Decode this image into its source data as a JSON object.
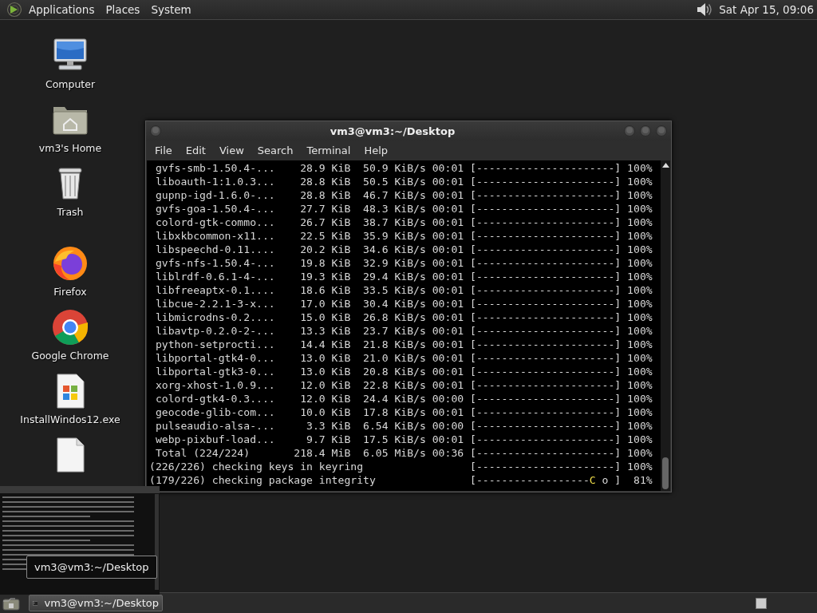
{
  "top_panel": {
    "menus": [
      {
        "label": "Applications"
      },
      {
        "label": "Places"
      },
      {
        "label": "System"
      }
    ],
    "clock": "Sat Apr 15, 09:06"
  },
  "desktop_icons": [
    {
      "kind": "computer",
      "label": "Computer"
    },
    {
      "kind": "home",
      "label": "vm3's Home"
    },
    {
      "kind": "trash",
      "label": "Trash"
    },
    {
      "kind": "firefox",
      "label": "Firefox"
    },
    {
      "kind": "chrome",
      "label": "Google Chrome"
    },
    {
      "kind": "exe",
      "label": "InstallWindos12.exe"
    },
    {
      "kind": "file"
    }
  ],
  "terminal": {
    "title": "vm3@vm3:~/Desktop",
    "menus": [
      {
        "label": "File"
      },
      {
        "label": "Edit"
      },
      {
        "label": "View"
      },
      {
        "label": "Search"
      },
      {
        "label": "Terminal"
      },
      {
        "label": "Help"
      }
    ],
    "lines": [
      {
        "kind": "text",
        "text": " gvfs-smb-1.50.4-...    28.9 KiB  50.9 KiB/s 00:01 [----------------------] 100%"
      },
      {
        "kind": "text",
        "text": " liboauth-1:1.0.3...    28.8 KiB  50.5 KiB/s 00:01 [----------------------] 100%"
      },
      {
        "kind": "text",
        "text": " gupnp-igd-1.6.0-...    28.8 KiB  46.7 KiB/s 00:01 [----------------------] 100%"
      },
      {
        "kind": "text",
        "text": " gvfs-goa-1.50.4-...    27.7 KiB  48.3 KiB/s 00:01 [----------------------] 100%"
      },
      {
        "kind": "text",
        "text": " colord-gtk-commo...    26.7 KiB  38.7 KiB/s 00:01 [----------------------] 100%"
      },
      {
        "kind": "text",
        "text": " libxkbcommon-x11...    22.5 KiB  35.9 KiB/s 00:01 [----------------------] 100%"
      },
      {
        "kind": "text",
        "text": " libspeechd-0.11....    20.2 KiB  34.6 KiB/s 00:01 [----------------------] 100%"
      },
      {
        "kind": "text",
        "text": " gvfs-nfs-1.50.4-...    19.8 KiB  32.9 KiB/s 00:01 [----------------------] 100%"
      },
      {
        "kind": "text",
        "text": " liblrdf-0.6.1-4-...    19.3 KiB  29.4 KiB/s 00:01 [----------------------] 100%"
      },
      {
        "kind": "text",
        "text": " libfreeaptx-0.1....    18.6 KiB  33.5 KiB/s 00:01 [----------------------] 100%"
      },
      {
        "kind": "text",
        "text": " libcue-2.2.1-3-x...    17.0 KiB  30.4 KiB/s 00:01 [----------------------] 100%"
      },
      {
        "kind": "text",
        "text": " libmicrodns-0.2....    15.0 KiB  26.8 KiB/s 00:01 [----------------------] 100%"
      },
      {
        "kind": "text",
        "text": " libavtp-0.2.0-2-...    13.3 KiB  23.7 KiB/s 00:01 [----------------------] 100%"
      },
      {
        "kind": "text",
        "text": " python-setprocti...    14.4 KiB  21.8 KiB/s 00:01 [----------------------] 100%"
      },
      {
        "kind": "text",
        "text": " libportal-gtk4-0...    13.0 KiB  21.0 KiB/s 00:01 [----------------------] 100%"
      },
      {
        "kind": "text",
        "text": " libportal-gtk3-0...    13.0 KiB  20.8 KiB/s 00:01 [----------------------] 100%"
      },
      {
        "kind": "text",
        "text": " xorg-xhost-1.0.9...    12.0 KiB  22.8 KiB/s 00:01 [----------------------] 100%"
      },
      {
        "kind": "text",
        "text": " colord-gtk4-0.3....    12.0 KiB  24.4 KiB/s 00:00 [----------------------] 100%"
      },
      {
        "kind": "text",
        "text": " geocode-glib-com...    10.0 KiB  17.8 KiB/s 00:01 [----------------------] 100%"
      },
      {
        "kind": "text",
        "text": " pulseaudio-alsa-...     3.3 KiB  6.54 KiB/s 00:00 [----------------------] 100%"
      },
      {
        "kind": "text",
        "text": " webp-pixbuf-load...     9.7 KiB  17.5 KiB/s 00:01 [----------------------] 100%"
      },
      {
        "kind": "text",
        "text": " Total (224/224)       218.4 MiB  6.05 MiB/s 00:36 [----------------------] 100%"
      },
      {
        "kind": "text",
        "text": "(226/226) checking keys in keyring                 [----------------------] 100%"
      },
      {
        "kind": "pacman",
        "before": "(179/226) checking package integrity               [------------------",
        "pacman": "C",
        "after": " o ]  81%"
      }
    ]
  },
  "tooltip": "vm3@vm3:~/Desktop",
  "taskbar": {
    "tasks": [
      {
        "label": "vm3@vm3:~/Desktop"
      }
    ]
  }
}
